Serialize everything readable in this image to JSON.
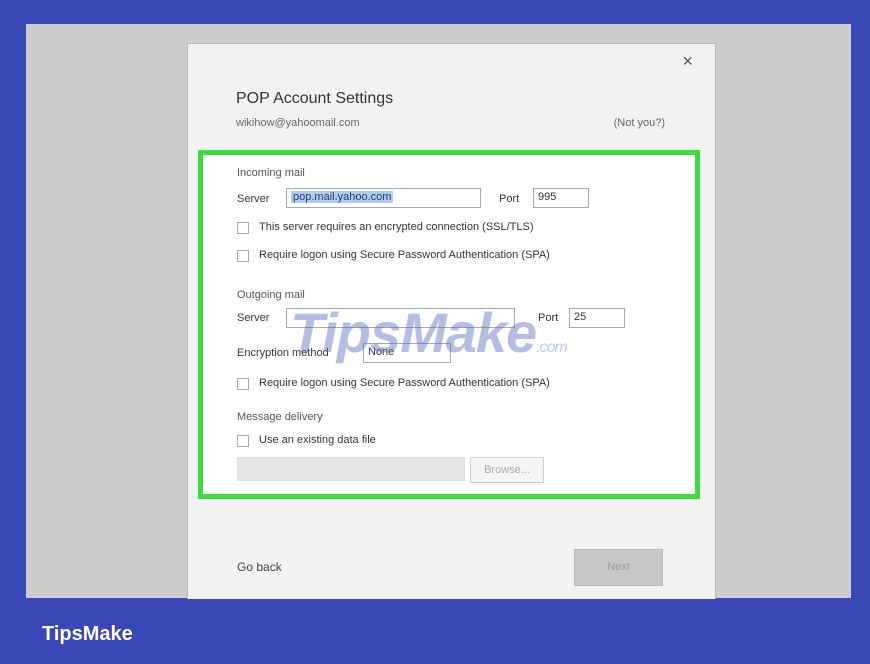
{
  "dialog": {
    "close_glyph": "×",
    "title": "POP Account Settings",
    "email": "wikihow@yahoomail.com",
    "not_you": "(Not you?)"
  },
  "incoming": {
    "heading": "Incoming mail",
    "server_label": "Server",
    "server_value": "pop.mail.yahoo.com",
    "port_label": "Port",
    "port_value": "995",
    "ssl_label": "This server requires an encrypted connection (SSL/TLS)",
    "spa_label": "Require logon using Secure Password Authentication (SPA)"
  },
  "outgoing": {
    "heading": "Outgoing mail",
    "server_label": "Server",
    "server_value": "",
    "port_label": "Port",
    "port_value": "25",
    "encryption_label": "Encryption method",
    "encryption_value": "None",
    "spa_label": "Require logon using Secure Password Authentication (SPA)"
  },
  "delivery": {
    "heading": "Message delivery",
    "existing_label": "Use an existing data file",
    "browse_label": "Browse..."
  },
  "footer": {
    "go_back": "Go back",
    "next": "Next"
  },
  "watermark": {
    "main": "TipsMake",
    "suffix": ".com"
  },
  "brand": "TipsMake",
  "colors": {
    "background": "#3a47b6",
    "highlight_border": "#3bdc3b",
    "selection": "#aecdf2"
  }
}
